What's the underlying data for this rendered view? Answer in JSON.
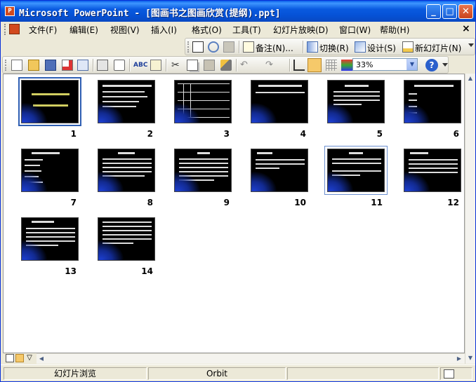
{
  "window": {
    "title": "Microsoft PowerPoint - [图画书之图画欣赏(提纲).ppt]",
    "app_icon": "powerpoint-icon"
  },
  "menu": {
    "items": [
      "文件(F)",
      "编辑(E)",
      "视图(V)",
      "插入(I)",
      "格式(O)",
      "工具(T)",
      "幻灯片放映(D)",
      "窗口(W)",
      "帮助(H)"
    ],
    "close": "×"
  },
  "toolbar_sorter": {
    "notes_label": "备注(N)...",
    "transition_label": "切换(R)",
    "design_label": "设计(S)",
    "new_slide_label": "新幻灯片(N)"
  },
  "toolbar_standard": {
    "zoom": "33%",
    "help": "?"
  },
  "slides": [
    {
      "number": "1"
    },
    {
      "number": "2"
    },
    {
      "number": "3"
    },
    {
      "number": "4"
    },
    {
      "number": "5"
    },
    {
      "number": "6"
    },
    {
      "number": "7"
    },
    {
      "number": "8"
    },
    {
      "number": "9"
    },
    {
      "number": "10"
    },
    {
      "number": "11"
    },
    {
      "number": "12"
    },
    {
      "number": "13"
    },
    {
      "number": "14"
    }
  ],
  "status": {
    "view": "幻灯片浏览",
    "design": "Orbit"
  },
  "colors": {
    "title_bar": "#0a5ae0",
    "selection": "#2f5fb3",
    "slide_bg": "#000000",
    "slide_accent": "#1d3fd0"
  }
}
